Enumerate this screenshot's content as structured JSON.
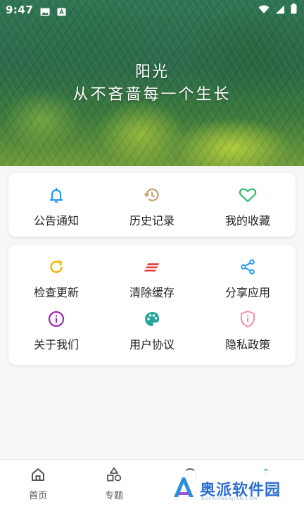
{
  "status_bar": {
    "time": "9:47"
  },
  "banner": {
    "title": "阳光",
    "subtitle": "从不吝啬每一个生长"
  },
  "menu_card_1": {
    "items": [
      {
        "label": "公告通知",
        "icon": "bell-icon",
        "color": "#2196f3"
      },
      {
        "label": "历史记录",
        "icon": "history-icon",
        "color": "#c8a070"
      },
      {
        "label": "我的收藏",
        "icon": "heart-icon",
        "color": "#2ebd6b"
      }
    ]
  },
  "menu_card_2": {
    "items": [
      {
        "label": "检查更新",
        "icon": "refresh-icon",
        "color": "#f5b400"
      },
      {
        "label": "清除缓存",
        "icon": "clear-cache-icon",
        "color": "#e53935"
      },
      {
        "label": "分享应用",
        "icon": "share-icon",
        "color": "#2196f3"
      },
      {
        "label": "关于我们",
        "icon": "info-icon",
        "color": "#9c27b0"
      },
      {
        "label": "用户协议",
        "icon": "palette-icon",
        "color": "#26a69a"
      },
      {
        "label": "隐私政策",
        "icon": "shield-icon",
        "color": "#f48fb1"
      }
    ]
  },
  "bottom_nav": {
    "items": [
      {
        "label": "首页",
        "icon": "home-icon"
      },
      {
        "label": "专题",
        "icon": "shapes-icon"
      }
    ]
  },
  "watermark": {
    "text": "奥派软件园",
    "sub": "AOPAIRUANJIAN.COM"
  }
}
